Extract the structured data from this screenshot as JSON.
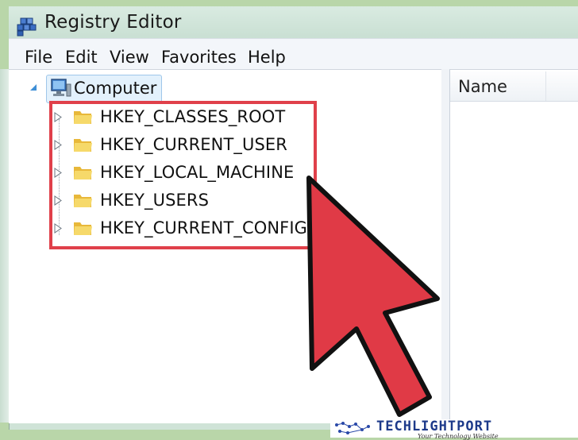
{
  "window": {
    "title": "Registry Editor"
  },
  "menu": [
    "File",
    "Edit",
    "View",
    "Favorites",
    "Help"
  ],
  "tree": {
    "root_label": "Computer",
    "keys": [
      {
        "label": "HKEY_CLASSES_ROOT"
      },
      {
        "label": "HKEY_CURRENT_USER"
      },
      {
        "label": "HKEY_LOCAL_MACHINE"
      },
      {
        "label": "HKEY_USERS"
      },
      {
        "label": "HKEY_CURRENT_CONFIG"
      }
    ]
  },
  "list": {
    "columns": [
      "Name"
    ]
  },
  "watermark": {
    "logo_text": "TECHLIGHTPORT",
    "tagline": "Your Technology Website"
  },
  "colors": {
    "highlight": "#e0404a",
    "arrow": "#e03a46",
    "folder": "#f3cf5a"
  },
  "icons": {
    "app": "registry-editor-icon",
    "computer": "computer-icon",
    "folder": "folder-icon",
    "expander": "triangle-right-icon"
  }
}
